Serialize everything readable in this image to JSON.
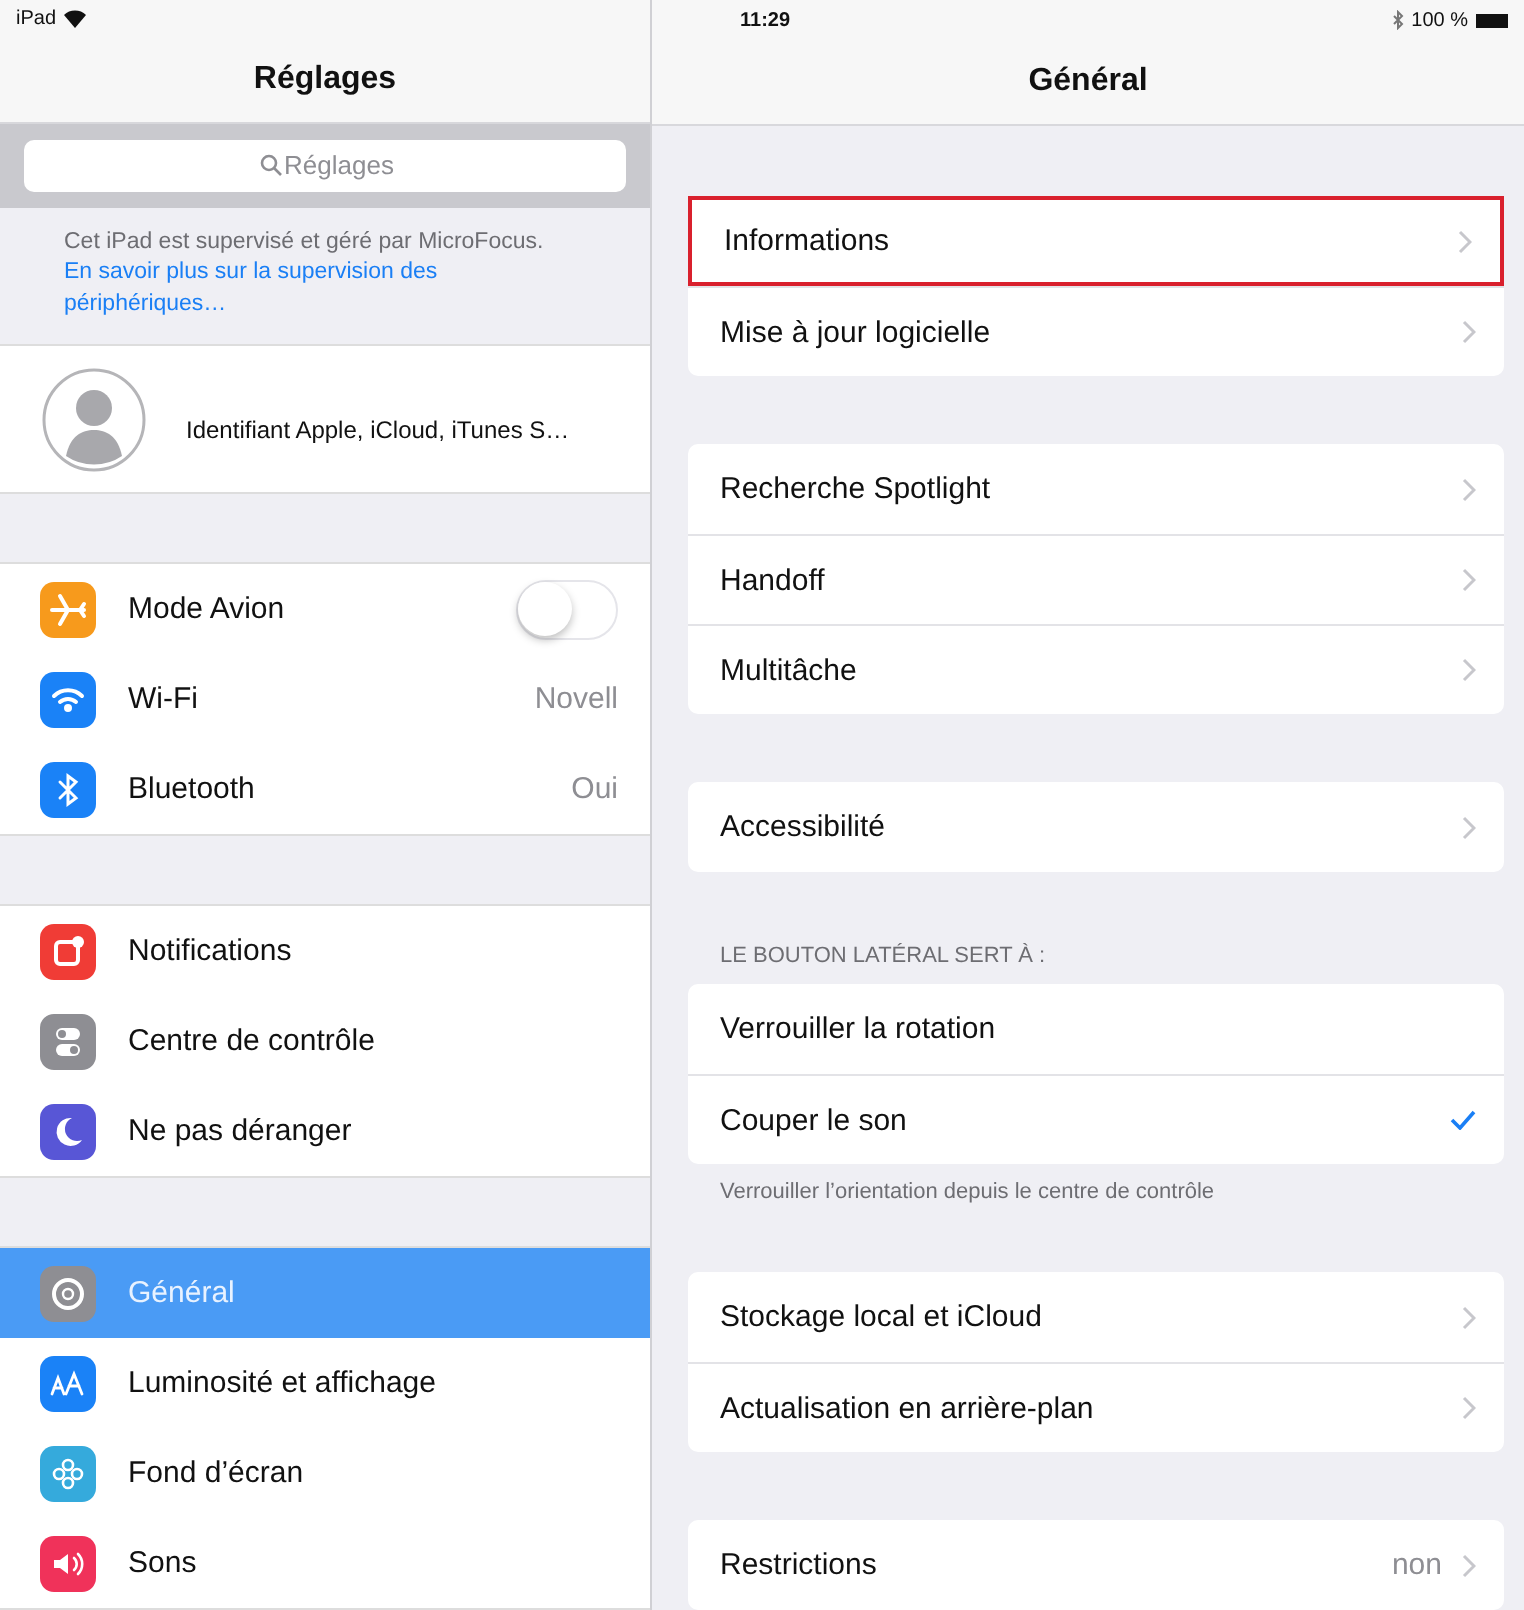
{
  "status_bar": {
    "device": "iPad",
    "time": "11:29",
    "battery": "100 %"
  },
  "sidebar": {
    "title": "Réglages",
    "search": {
      "placeholder": "Réglages"
    },
    "notice": {
      "text": "Cet iPad est supervisé et géré par MicroFocus.",
      "link": "En savoir plus sur la supervision des périphériques…"
    },
    "profile": {
      "label": "Identifiant Apple, iCloud, iTunes S…"
    },
    "groups": [
      [
        {
          "label": "Mode Avion",
          "kind": "toggle",
          "on": false,
          "color": "#f79a1c",
          "selected": false
        },
        {
          "label": "Wi-Fi",
          "kind": "value",
          "value": "Novell",
          "color": "#1a82f7",
          "selected": false
        },
        {
          "label": "Bluetooth",
          "kind": "value",
          "value": "Oui",
          "color": "#1a82f7",
          "selected": false
        }
      ],
      [
        {
          "label": "Notifications",
          "kind": "plain",
          "color": "#f03c36",
          "selected": false
        },
        {
          "label": "Centre de contrôle",
          "kind": "plain",
          "color": "#8e8e93",
          "selected": false
        },
        {
          "label": "Ne pas déranger",
          "kind": "plain",
          "color": "#5856d6",
          "selected": false
        }
      ],
      [
        {
          "label": "Général",
          "kind": "plain",
          "color": "#8e8e93",
          "selected": true
        },
        {
          "label": "Luminosité et affichage",
          "kind": "plain",
          "color": "#1a82f7",
          "selected": false
        },
        {
          "label": "Fond d’écran",
          "kind": "plain",
          "color": "#35aadc",
          "selected": false
        },
        {
          "label": "Sons",
          "kind": "plain",
          "color": "#f0325a",
          "selected": false
        }
      ]
    ]
  },
  "detail": {
    "title": "Général",
    "groups": [
      {
        "items": [
          {
            "label": "Informations",
            "kind": "link",
            "highlighted": true
          },
          {
            "label": "Mise à jour logicielle",
            "kind": "link",
            "highlighted": false
          }
        ]
      },
      {
        "items": [
          {
            "label": "Recherche Spotlight",
            "kind": "link",
            "highlighted": false
          },
          {
            "label": "Handoff",
            "kind": "link",
            "highlighted": false
          },
          {
            "label": "Multitâche",
            "kind": "link",
            "highlighted": false
          }
        ]
      },
      {
        "items": [
          {
            "label": "Accessibilité",
            "kind": "link",
            "highlighted": false
          }
        ]
      },
      {
        "header": "LE BOUTON LATÉRAL SERT À :",
        "footer": "Verrouiller l’orientation depuis le centre de contrôle",
        "items": [
          {
            "label": "Verrouiller la rotation",
            "kind": "choice",
            "selected": false,
            "highlighted": false
          },
          {
            "label": "Couper le son",
            "kind": "choice",
            "selected": true,
            "highlighted": false
          }
        ]
      },
      {
        "items": [
          {
            "label": "Stockage local et iCloud",
            "kind": "link",
            "highlighted": false
          },
          {
            "label": "Actualisation en arrière-plan",
            "kind": "link",
            "highlighted": false
          }
        ]
      },
      {
        "items": [
          {
            "label": "Restrictions",
            "kind": "link",
            "value": "non",
            "highlighted": false
          }
        ]
      }
    ]
  }
}
